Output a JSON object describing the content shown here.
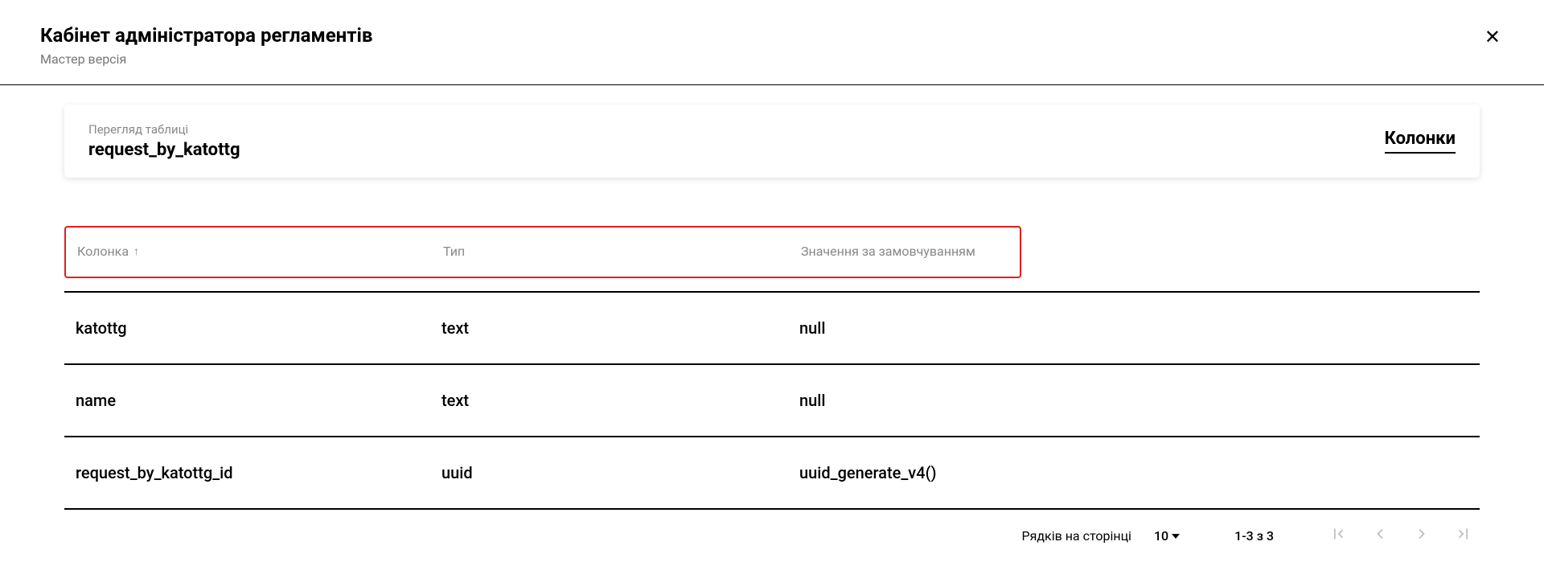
{
  "header": {
    "title": "Кабінет адміністратора регламентів",
    "subtitle": "Мастер версія"
  },
  "card": {
    "label": "Перегляд таблиці",
    "name": "request_by_katottg",
    "columns_btn": "Колонки"
  },
  "table": {
    "headers": {
      "col": "Колонка",
      "type": "Тип",
      "default": "Значення за замовчуванням"
    },
    "rows": [
      {
        "col": "katottg",
        "type": "text",
        "default": "null"
      },
      {
        "col": "name",
        "type": "text",
        "default": "null"
      },
      {
        "col": "request_by_katottg_id",
        "type": "uuid",
        "default": "uuid_generate_v4()"
      }
    ]
  },
  "pagination": {
    "rows_label": "Рядків на сторінці",
    "rows_value": "10",
    "range": "1-3 з 3"
  }
}
